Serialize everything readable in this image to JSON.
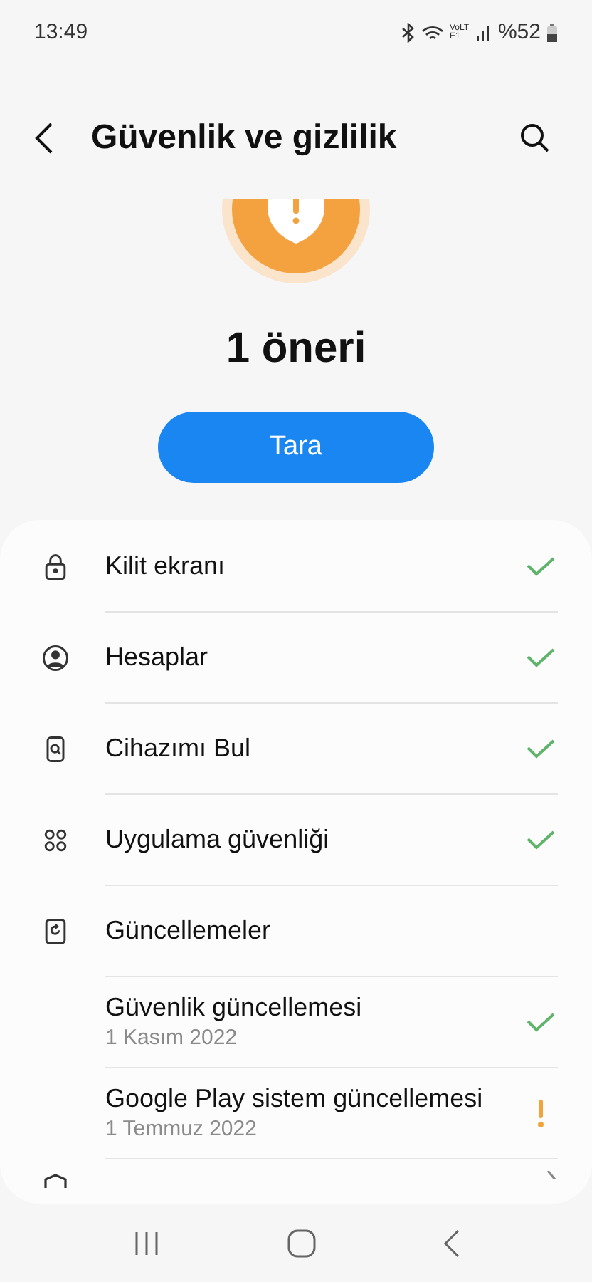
{
  "status_bar": {
    "time": "13:49",
    "battery": "%52",
    "network": "VoLTE1"
  },
  "header": {
    "title": "Güvenlik ve gizlilik"
  },
  "summary": {
    "attention": true,
    "text": "1 öneri",
    "button": "Tara"
  },
  "items": [
    {
      "label": "Kilit ekranı",
      "attention": false
    },
    {
      "label": "Hesaplar",
      "attention": false
    },
    {
      "label": "Cihazımı Bul",
      "attention": false
    },
    {
      "label": "Uygulama güvenliği",
      "attention": false
    },
    {
      "label": "Güncellemeler",
      "children": [
        {
          "label": "Güvenlik güncellemesi",
          "subtitle": "1 Kasım 2022",
          "attention": false
        },
        {
          "label": "Google Play sistem güncellemesi",
          "subtitle": "1 Temmuz 2022",
          "attention": true
        }
      ]
    }
  ]
}
